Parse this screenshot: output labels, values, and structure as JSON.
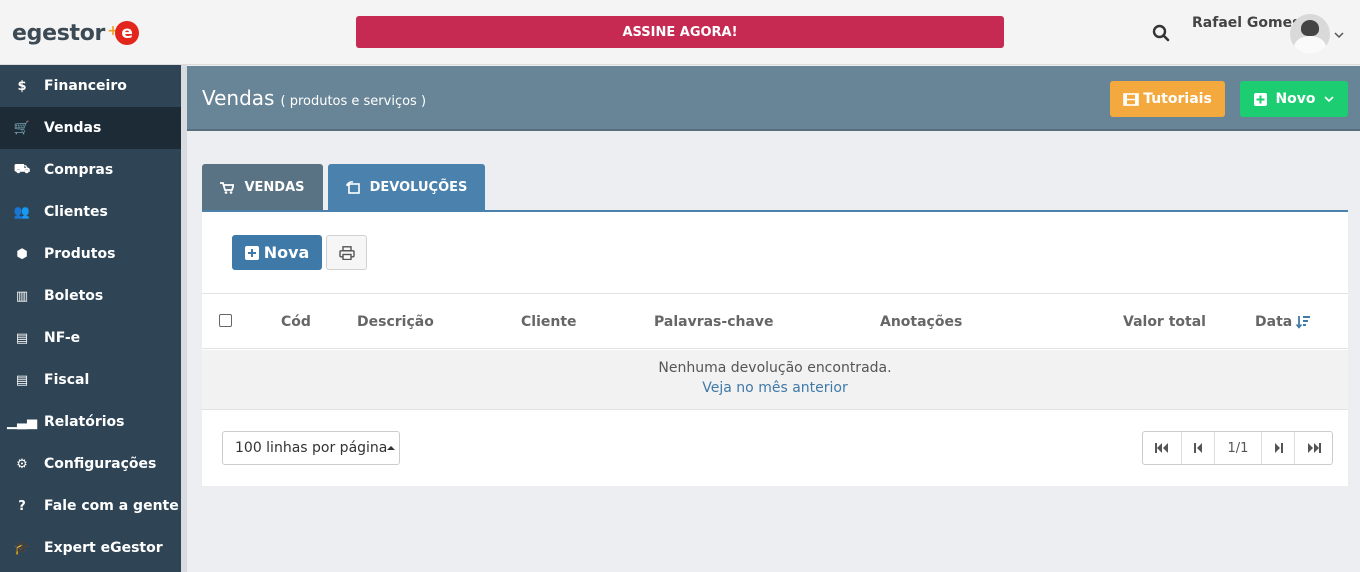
{
  "brand": {
    "logo_text": "egestor",
    "logo_badge": "e"
  },
  "topbar": {
    "cta_label": "ASSINE AGORA!",
    "user_name": "Rafael Gomes"
  },
  "sidebar": {
    "items": [
      {
        "label": "Financeiro",
        "icon": "dollar-icon",
        "glyph": "$"
      },
      {
        "label": "Vendas",
        "icon": "cart-icon",
        "glyph": "🛒"
      },
      {
        "label": "Compras",
        "icon": "truck-icon",
        "glyph": "⛟"
      },
      {
        "label": "Clientes",
        "icon": "users-icon",
        "glyph": "👥"
      },
      {
        "label": "Produtos",
        "icon": "cubes-icon",
        "glyph": "⬢"
      },
      {
        "label": "Boletos",
        "icon": "barcode-icon",
        "glyph": "▥"
      },
      {
        "label": "NF-e",
        "icon": "document-icon",
        "glyph": "▤"
      },
      {
        "label": "Fiscal",
        "icon": "document-icon",
        "glyph": "▤"
      },
      {
        "label": "Relatórios",
        "icon": "bar-chart-icon",
        "glyph": "▁▃▅"
      },
      {
        "label": "Configurações",
        "icon": "gear-icon",
        "glyph": "⚙"
      },
      {
        "label": "Fale com a gente",
        "icon": "question-icon",
        "glyph": "?"
      },
      {
        "label": "Expert eGestor",
        "icon": "graduation-cap-icon",
        "glyph": "🎓"
      }
    ],
    "active_index": 1
  },
  "header": {
    "title": "Vendas",
    "subtitle": "( produtos e serviços )",
    "tutorials_label": "Tutoriais",
    "new_label": "Novo"
  },
  "tabs": [
    {
      "label": "VENDAS",
      "icon": "cart-icon"
    },
    {
      "label": "DEVOLUÇÕES",
      "icon": "return-icon"
    }
  ],
  "toolbar": {
    "new_label": "Nova"
  },
  "table": {
    "columns": [
      "Cód",
      "Descrição",
      "Cliente",
      "Palavras-chave",
      "Anotações",
      "Valor total",
      "Data"
    ],
    "empty_message": "Nenhuma devolução encontrada.",
    "empty_link": "Veja no mês anterior"
  },
  "footer": {
    "rows_per_page": "100 linhas por página",
    "page_indicator": "1/1"
  },
  "colors": {
    "sidebar": "#2f4555",
    "cta": "#c62a52",
    "tutorials": "#f4a93f",
    "new": "#1ccd72",
    "primary": "#3f79a8"
  }
}
